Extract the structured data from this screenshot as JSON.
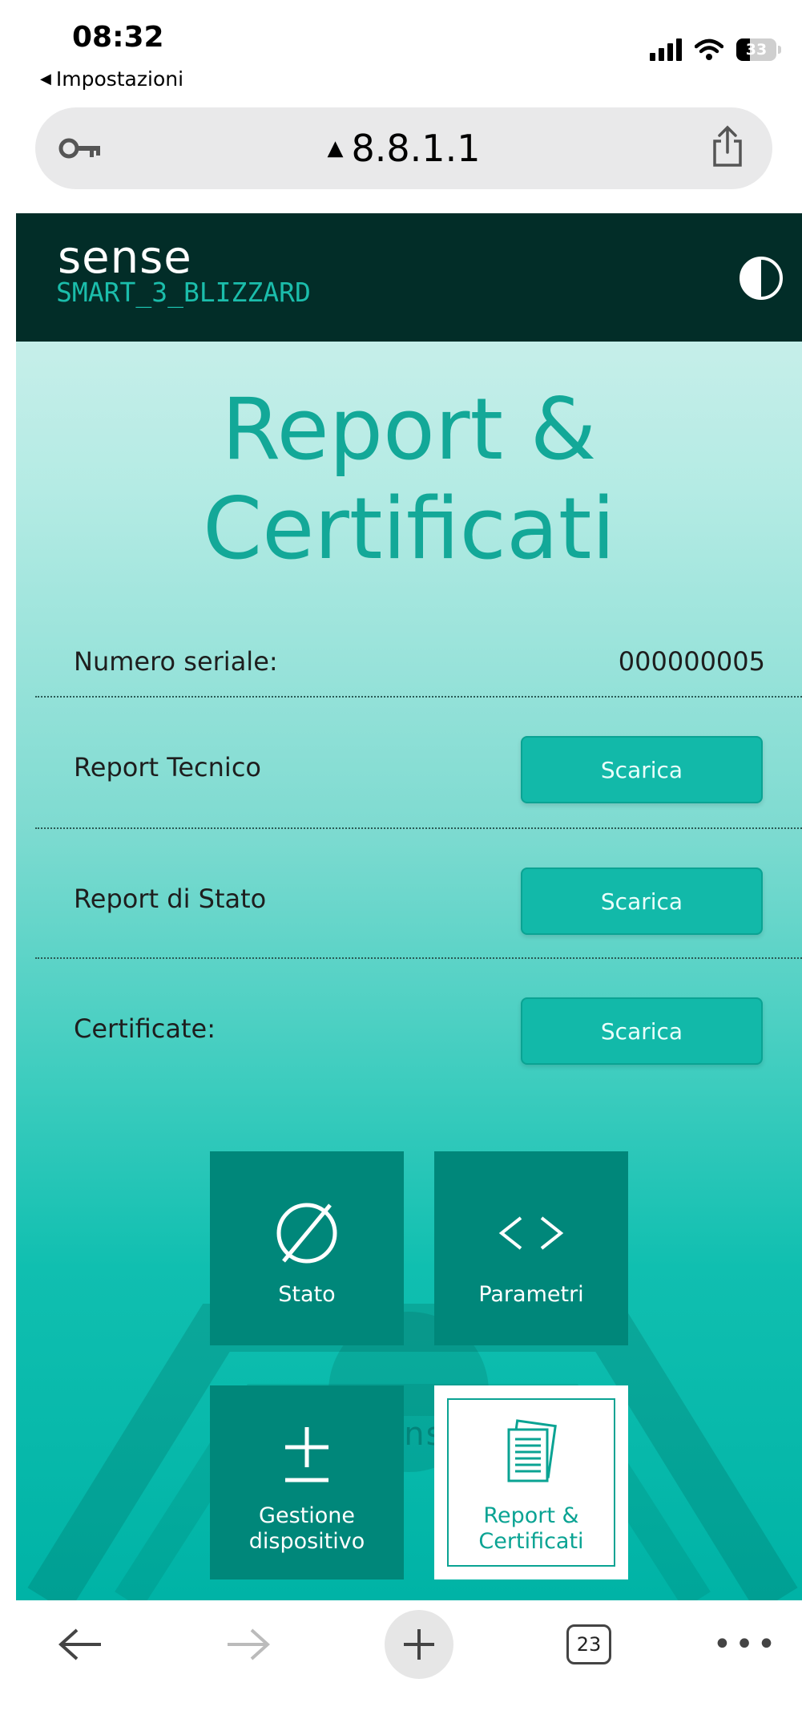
{
  "status_bar": {
    "time": "08:32",
    "back_label": "Impostazioni",
    "battery": "33"
  },
  "browser": {
    "url": "8.8.1.1",
    "tabs_count": "23"
  },
  "header": {
    "brand": "sense",
    "device": "SMART_3_BLIZZARD"
  },
  "page": {
    "title_line1": "Report &",
    "title_line2": "Certificati",
    "rows": [
      {
        "label": "Numero seriale:",
        "value": "000000005"
      },
      {
        "label": "Report Tecnico",
        "button": "Scarica"
      },
      {
        "label": "Report di Stato",
        "button": "Scarica"
      },
      {
        "label": "Certificate:",
        "button": "Scarica"
      }
    ]
  },
  "nav_tiles": [
    {
      "label": "Stato",
      "icon": "empty-set-icon"
    },
    {
      "label": "Parametri",
      "icon": "code-brackets-icon"
    },
    {
      "label_line1": "Gestione",
      "label_line2": "dispositivo",
      "icon": "plus-minus-icon"
    },
    {
      "label_line1": "Report &",
      "label_line2": "Certificati",
      "icon": "documents-icon"
    }
  ],
  "watermark": "sensit",
  "colors": {
    "header_bg": "#022d28",
    "accent": "#13a898",
    "tile_bg": "#00877a",
    "button_bg": "#12b9a9"
  }
}
